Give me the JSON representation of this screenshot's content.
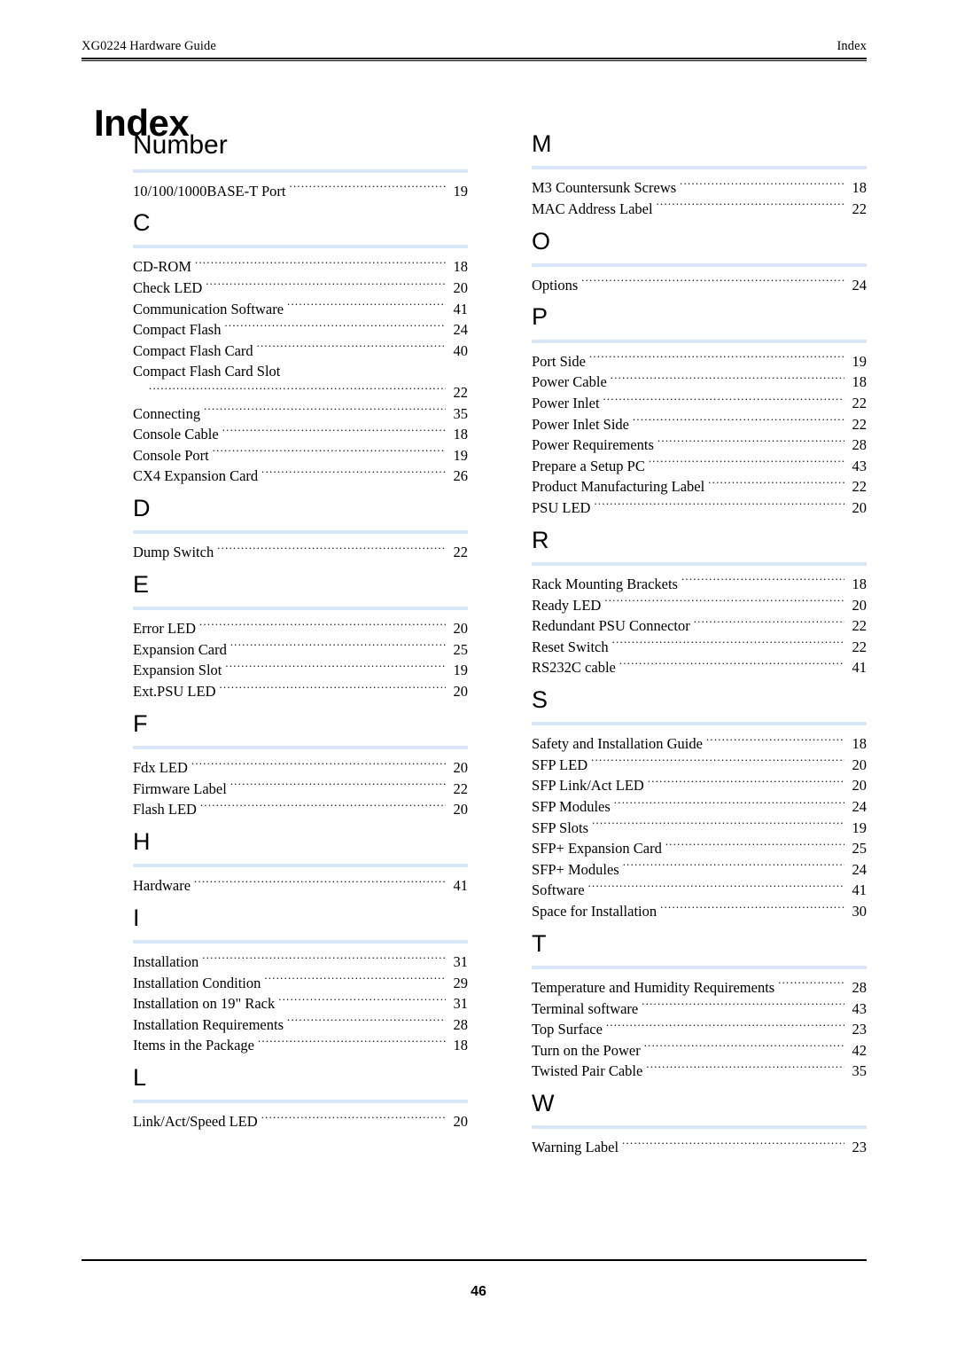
{
  "header": {
    "left_text": "XG0224 Hardware Guide",
    "right_text": "Index"
  },
  "title": "Index",
  "footer": {
    "page_number": "46"
  },
  "colors": {
    "section_rule": "#d7e7f7",
    "text": "#000000",
    "background": "#ffffff"
  },
  "columns": {
    "left": [
      {
        "letter": "Number",
        "entries": [
          {
            "label": "10/100/1000BASE-T Port",
            "page": "19"
          }
        ]
      },
      {
        "letter": "C",
        "entries": [
          {
            "label": "CD-ROM",
            "page": "18"
          },
          {
            "label": "Check LED",
            "page": "20"
          },
          {
            "label": "Communication Software",
            "page": "41"
          },
          {
            "label": "Compact Flash",
            "page": "24"
          },
          {
            "label": "Compact Flash Card",
            "page": "40"
          },
          {
            "label": "Compact Flash Card Slot",
            "page": "22",
            "wrap": true
          },
          {
            "label": "Connecting",
            "page": "35"
          },
          {
            "label": "Console Cable",
            "page": "18"
          },
          {
            "label": "Console Port",
            "page": "19"
          },
          {
            "label": "CX4 Expansion Card",
            "page": "26"
          }
        ]
      },
      {
        "letter": "D",
        "entries": [
          {
            "label": "Dump Switch",
            "page": "22"
          }
        ]
      },
      {
        "letter": "E",
        "entries": [
          {
            "label": "Error LED",
            "page": "20"
          },
          {
            "label": "Expansion Card",
            "page": "25"
          },
          {
            "label": "Expansion Slot",
            "page": "19"
          },
          {
            "label": "Ext.PSU LED",
            "page": "20"
          }
        ]
      },
      {
        "letter": "F",
        "entries": [
          {
            "label": "Fdx LED",
            "page": "20"
          },
          {
            "label": "Firmware Label",
            "page": "22"
          },
          {
            "label": "Flash LED",
            "page": "20"
          }
        ]
      },
      {
        "letter": "H",
        "entries": [
          {
            "label": "Hardware",
            "page": "41"
          }
        ]
      },
      {
        "letter": "I",
        "entries": [
          {
            "label": "Installation",
            "page": "31"
          },
          {
            "label": "Installation Condition",
            "page": "29"
          },
          {
            "label": "Installation on 19\" Rack",
            "page": "31"
          },
          {
            "label": "Installation Requirements",
            "page": "28"
          },
          {
            "label": "Items in the Package",
            "page": "18"
          }
        ]
      },
      {
        "letter": "L",
        "entries": [
          {
            "label": "Link/Act/Speed LED",
            "page": "20"
          }
        ]
      }
    ],
    "right": [
      {
        "letter": "M",
        "entries": [
          {
            "label": "M3 Countersunk Screws",
            "page": "18"
          },
          {
            "label": "MAC Address Label",
            "page": "22"
          }
        ]
      },
      {
        "letter": "O",
        "entries": [
          {
            "label": "Options",
            "page": "24"
          }
        ]
      },
      {
        "letter": "P",
        "entries": [
          {
            "label": "Port Side",
            "page": "19"
          },
          {
            "label": "Power Cable",
            "page": "18"
          },
          {
            "label": "Power Inlet",
            "page": "22"
          },
          {
            "label": "Power Inlet Side",
            "page": "22"
          },
          {
            "label": "Power Requirements",
            "page": "28"
          },
          {
            "label": "Prepare a Setup PC",
            "page": "43"
          },
          {
            "label": "Product Manufacturing Label",
            "page": "22"
          },
          {
            "label": "PSU LED",
            "page": "20"
          }
        ]
      },
      {
        "letter": "R",
        "entries": [
          {
            "label": "Rack Mounting Brackets",
            "page": "18"
          },
          {
            "label": "Ready LED",
            "page": "20"
          },
          {
            "label": "Redundant PSU Connector",
            "page": "22"
          },
          {
            "label": "Reset Switch",
            "page": "22"
          },
          {
            "label": "RS232C cable",
            "page": "41"
          }
        ]
      },
      {
        "letter": "S",
        "entries": [
          {
            "label": "Safety and Installation Guide",
            "page": "18"
          },
          {
            "label": "SFP LED",
            "page": "20"
          },
          {
            "label": "SFP Link/Act LED",
            "page": "20"
          },
          {
            "label": "SFP Modules",
            "page": "24"
          },
          {
            "label": "SFP Slots",
            "page": "19"
          },
          {
            "label": "SFP+ Expansion Card",
            "page": "25"
          },
          {
            "label": "SFP+ Modules",
            "page": "24"
          },
          {
            "label": "Software",
            "page": "41"
          },
          {
            "label": "Space for Installation",
            "page": "30"
          }
        ]
      },
      {
        "letter": "T",
        "entries": [
          {
            "label": "Temperature and Humidity Requirements",
            "page": "28"
          },
          {
            "label": "Terminal software",
            "page": "43"
          },
          {
            "label": "Top Surface",
            "page": "23"
          },
          {
            "label": "Turn on the Power",
            "page": "42"
          },
          {
            "label": "Twisted Pair Cable",
            "page": "35"
          }
        ]
      },
      {
        "letter": "W",
        "entries": [
          {
            "label": "Warning Label",
            "page": "23"
          }
        ]
      }
    ]
  }
}
